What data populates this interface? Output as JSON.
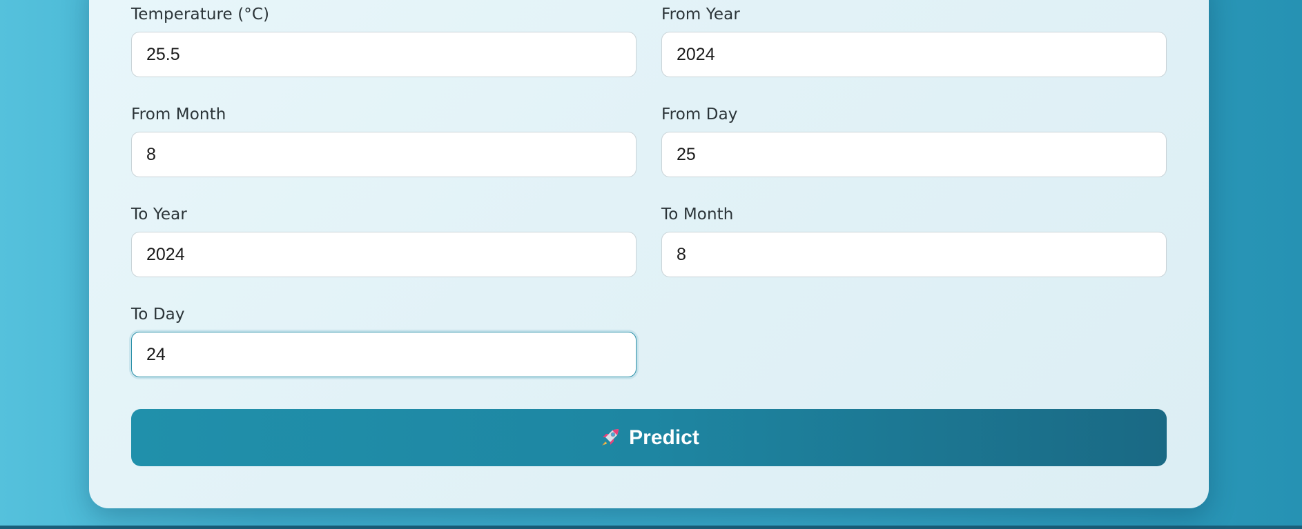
{
  "form": {
    "fields": [
      {
        "id": "temperature",
        "label": "Temperature (°C)",
        "value": "25.5"
      },
      {
        "id": "from_year",
        "label": "From Year",
        "value": "2024"
      },
      {
        "id": "from_month",
        "label": "From Month",
        "value": "8"
      },
      {
        "id": "from_day",
        "label": "From Day",
        "value": "25"
      },
      {
        "id": "to_year",
        "label": "To Year",
        "value": "2024"
      },
      {
        "id": "to_month",
        "label": "To Month",
        "value": "8"
      },
      {
        "id": "to_day",
        "label": "To Day",
        "value": "24"
      }
    ],
    "focused_field": "to_day",
    "submit": {
      "label": "Predict",
      "icon": "rocket-icon"
    }
  },
  "colors": {
    "accent": "#2090ab",
    "accent_dark": "#1a6984",
    "background": "#3fb0cf",
    "card": "#e2f2f7"
  }
}
